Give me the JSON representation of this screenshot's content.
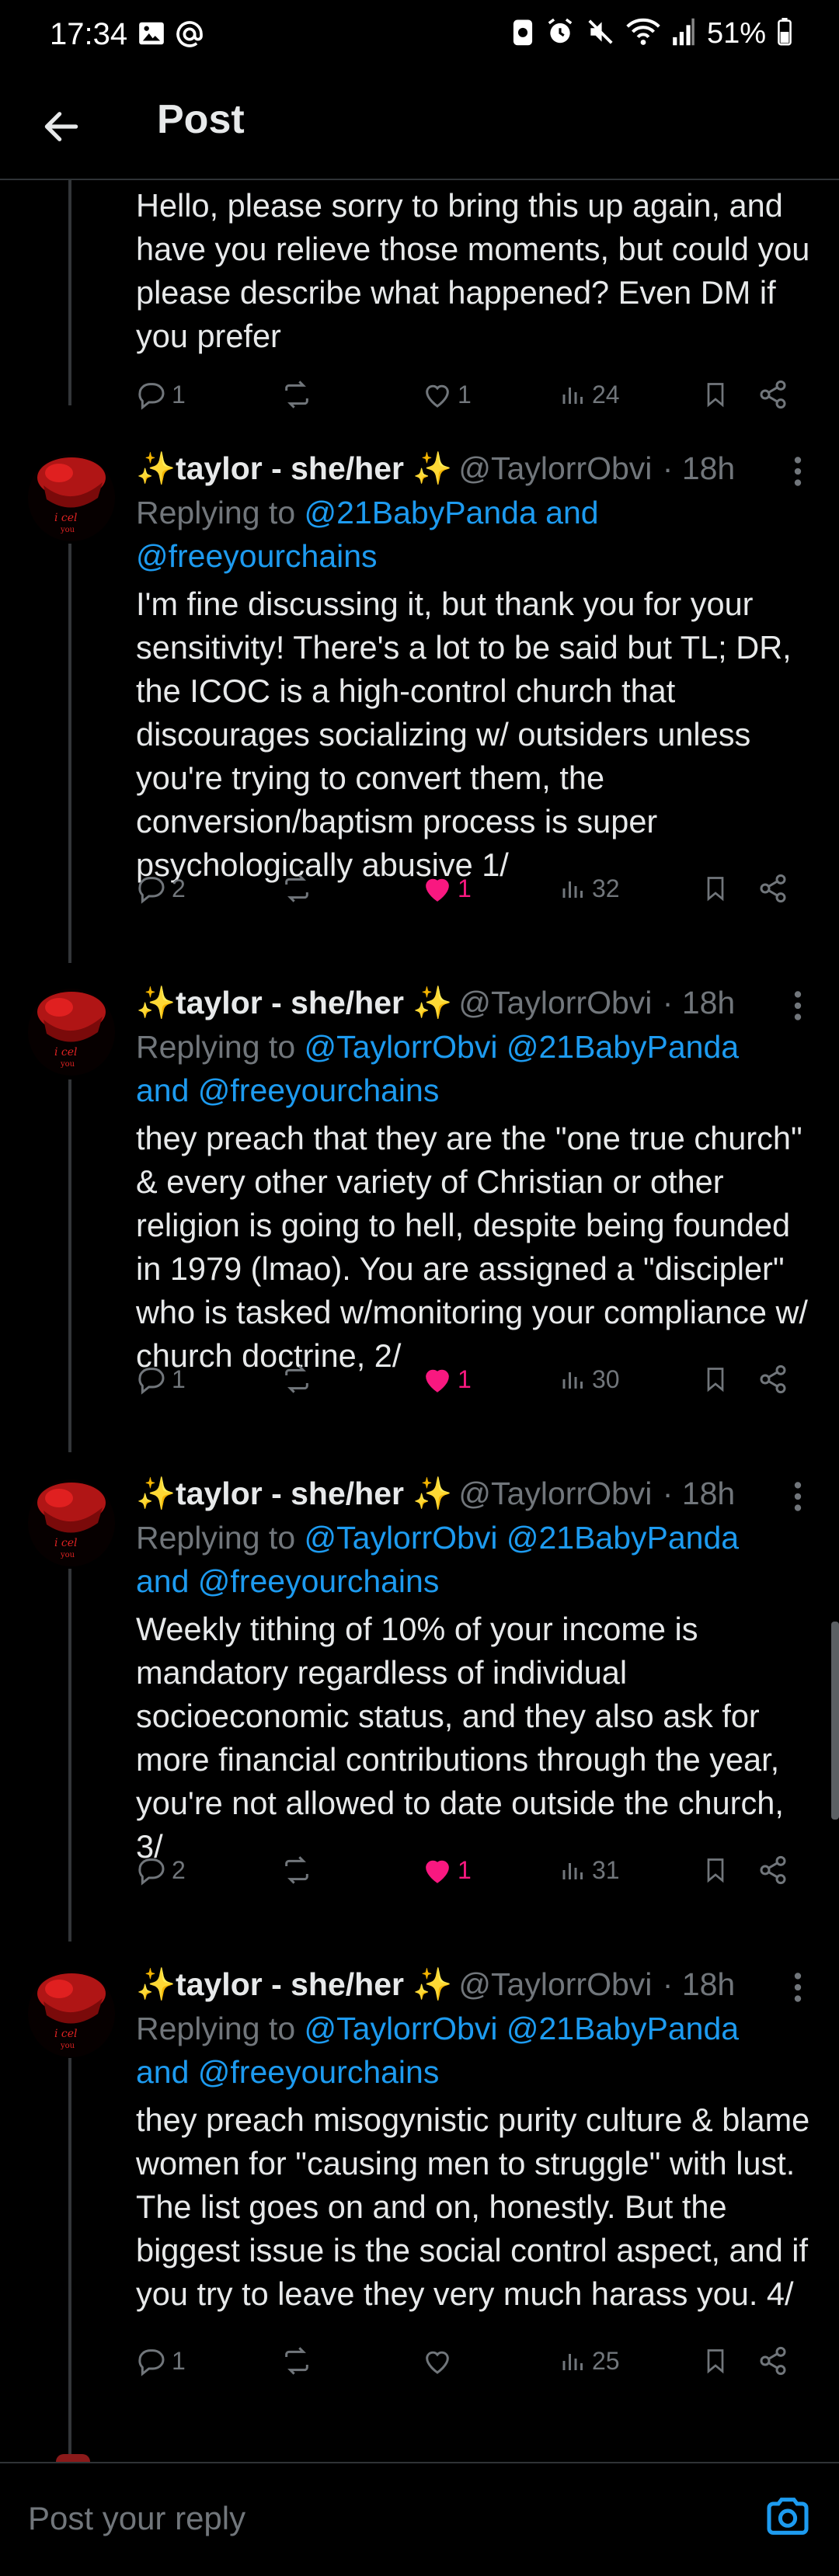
{
  "status_bar": {
    "time": "17:34",
    "battery": "51%",
    "icons": [
      "image-icon",
      "at-icon",
      "data-saver-icon",
      "alarm-icon",
      "mute-icon",
      "wifi-icon",
      "signal-icon",
      "battery-icon"
    ]
  },
  "header": {
    "title": "Post",
    "back_icon": "arrow-left-icon"
  },
  "first_tweet": {
    "text": "Hello, please sorry to bring this up again, and have you relieve those moments, but could you please describe what happened? Even DM if you prefer",
    "actions": {
      "replies": "1",
      "retweets": "",
      "likes": "1",
      "views": "24",
      "liked": false
    }
  },
  "tweets": [
    {
      "name": "✨taylor - she/her ✨",
      "handle": "@TaylorrObvi",
      "time": "· 18h",
      "replying_prefix": "Replying to ",
      "replying_lines": [
        "@21BabyPanda and",
        "@freeyourchains"
      ],
      "text": "I'm fine discussing it, but thank you for your sensitivity! There's a lot to be said but TL; DR, the ICOC is a high-control church that discourages socializing w/ outsiders unless you're trying to convert them, the conversion/baptism process is super psychologically abusive 1/",
      "actions": {
        "replies": "2",
        "likes": "1",
        "views": "32",
        "liked": true
      }
    },
    {
      "name": "✨taylor - she/her ✨",
      "handle": "@TaylorrObvi",
      "time": "· 18h",
      "replying_prefix": "Replying to ",
      "replying_lines": [
        "@TaylorrObvi @21BabyPanda",
        "and @freeyourchains"
      ],
      "text": "they preach that they are the \"one true church\" & every other variety of Christian or other religion is going to hell, despite being founded in 1979 (lmao). You are assigned a \"discipler\" who is tasked w/monitoring your compliance w/ church doctrine, 2/",
      "actions": {
        "replies": "1",
        "likes": "1",
        "views": "30",
        "liked": true
      }
    },
    {
      "name": "✨taylor - she/her ✨",
      "handle": "@TaylorrObvi",
      "time": "· 18h",
      "replying_prefix": "Replying to ",
      "replying_lines": [
        "@TaylorrObvi @21BabyPanda",
        "and @freeyourchains"
      ],
      "text": "Weekly tithing of 10% of your income is mandatory regardless of individual socioeconomic status, and they also ask for more financial contributions through the year, you're not allowed to date outside the church, 3/",
      "actions": {
        "replies": "2",
        "likes": "1",
        "views": "31",
        "liked": true
      }
    },
    {
      "name": "✨taylor - she/her ✨",
      "handle": "@TaylorrObvi",
      "time": "· 18h",
      "replying_prefix": "Replying to ",
      "replying_lines": [
        "@TaylorrObvi @21BabyPanda",
        "and @freeyourchains"
      ],
      "text": "they preach misogynistic purity culture & blame women for \"causing men to struggle\" with lust. The list goes on and on, honestly. But the biggest issue is the social control aspect, and if you try to leave they very much harass you. 4/",
      "actions": {
        "replies": "1",
        "likes": "",
        "views": "25",
        "liked": false
      }
    }
  ],
  "reply_bar": {
    "placeholder": "Post your reply",
    "camera_icon": "camera-icon"
  },
  "colors": {
    "background": "#000000",
    "text": "#e7e9ea",
    "muted": "#71767b",
    "link": "#1d9bf0",
    "like": "#f91880",
    "divider": "#2f3336"
  }
}
